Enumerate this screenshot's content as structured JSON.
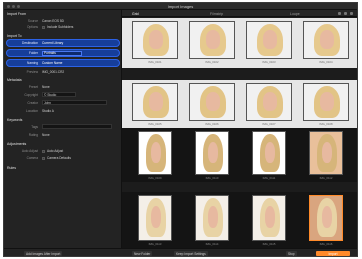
{
  "window": {
    "title": "Import Images",
    "accent": "#ff8a2a",
    "selection": "#2c62e6"
  },
  "tabs": [
    "Grid",
    "Filmstrip",
    "Loupe"
  ],
  "sidebar": {
    "sections": [
      "Import From",
      "Import To",
      "Metadata",
      "Keywords",
      "Adjustments",
      "Rules"
    ],
    "fields": [
      {
        "label": "Source",
        "value": "Canon EOS 5D"
      },
      {
        "label": "Options",
        "value": "Include Subfolders"
      },
      {
        "label": "Destination",
        "value": "Current Library"
      },
      {
        "label": "Folder",
        "value": "Portraits"
      },
      {
        "label": "Naming",
        "value": "Custom Name"
      },
      {
        "label": "Preview",
        "value": "IMG_0001.CR2"
      },
      {
        "label": "Preset",
        "value": "None"
      },
      {
        "label": "Copyright",
        "value": "© Studio"
      },
      {
        "label": "Creator",
        "value": "John"
      },
      {
        "label": "Location",
        "value": "Studio A"
      },
      {
        "label": "Tags",
        "value": ""
      },
      {
        "label": "Rating",
        "value": "None"
      },
      {
        "label": "Auto Adjust",
        "value": "Auto Adjust"
      },
      {
        "label": "Camera",
        "value": "Camera Defaults"
      }
    ]
  },
  "thumb_labels": [
    "IMG_0101",
    "IMG_0102",
    "IMG_0103",
    "IMG_0104",
    "IMG_0105",
    "IMG_0106",
    "IMG_0107",
    "IMG_0108",
    "IMG_0109",
    "IMG_0110",
    "IMG_0111",
    "IMG_0112",
    "IMG_0113",
    "IMG_0114",
    "IMG_0115",
    "IMG_0116"
  ],
  "bottom": {
    "left": "Add Images After Import",
    "mid1": "New Folder",
    "mid2": "Keep Import Settings",
    "stop": "Stop",
    "import": "Import"
  }
}
